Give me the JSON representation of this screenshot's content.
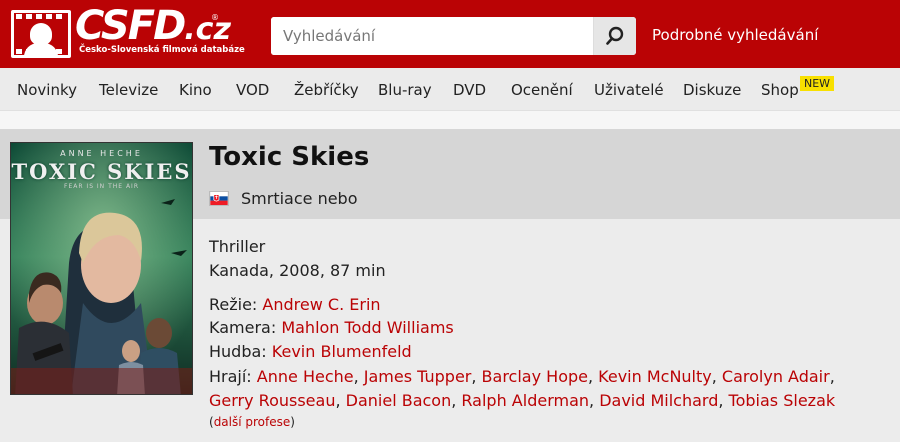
{
  "brand": {
    "logo_text": "CSFD.cz",
    "logo_word": "CSFD",
    "logo_tld": ".cz",
    "registered": "®",
    "tagline": "Česko-Slovenská filmová databáze",
    "brand_color": "#ba0305"
  },
  "search": {
    "placeholder": "Vyhledávání",
    "value": "",
    "icon": "search-icon",
    "advanced_label": "Podrobné vyhledávání"
  },
  "nav": {
    "items": [
      {
        "label": "Novinky"
      },
      {
        "label": "Televize"
      },
      {
        "label": "Kino"
      },
      {
        "label": "VOD"
      },
      {
        "label": "Žebříčky"
      },
      {
        "label": "Blu-ray"
      },
      {
        "label": "DVD"
      },
      {
        "label": "Ocenění"
      },
      {
        "label": "Uživatelé"
      },
      {
        "label": "Diskuze"
      },
      {
        "label": "Shop"
      }
    ],
    "new_badge": "NEW",
    "badge_color": "#f8e000"
  },
  "film": {
    "title": "Toxic Skies",
    "alt_title_flag": "slovakia-flag-icon",
    "alt_title": "Smrtiace nebo",
    "genre": "Thriller",
    "origin": "Kanada, 2008, 87 min",
    "poster": {
      "actor": "ANNE HECHE",
      "title": "TOXIC SKIES",
      "tagline": "FEAR IS IN THE AIR"
    },
    "credits": {
      "director_label": "Režie:",
      "director": "Andrew C. Erin",
      "camera_label": "Kamera:",
      "camera": "Mahlon Todd Williams",
      "music_label": "Hudba:",
      "music": "Kevin Blumenfeld",
      "cast_label": "Hrají:",
      "cast": [
        "Anne Heche",
        "James Tupper",
        "Barclay Hope",
        "Kevin McNulty",
        "Carolyn Adair",
        "Gerry Rousseau",
        "Daniel Bacon",
        "Ralph Alderman",
        "David Milchard",
        "Tobias Slezak"
      ],
      "separator": ", "
    },
    "more_professions": "další profese",
    "more_open": "(",
    "more_close": ")",
    "link_color": "#ba0305"
  }
}
